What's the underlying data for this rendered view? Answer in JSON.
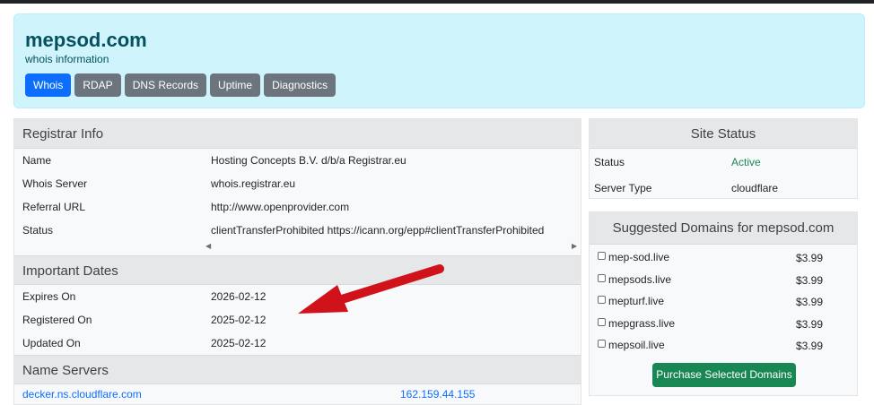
{
  "header": {
    "title": "mepsod.com",
    "subtitle": "whois information",
    "tabs": [
      {
        "label": "Whois"
      },
      {
        "label": "RDAP"
      },
      {
        "label": "DNS Records"
      },
      {
        "label": "Uptime"
      },
      {
        "label": "Diagnostics"
      }
    ]
  },
  "registrar": {
    "heading": "Registrar Info",
    "rows": [
      {
        "key": "Name",
        "value": "Hosting Concepts B.V. d/b/a Registrar.eu"
      },
      {
        "key": "Whois Server",
        "value": "whois.registrar.eu"
      },
      {
        "key": "Referral URL",
        "value": "http://www.openprovider.com"
      },
      {
        "key": "Status",
        "value": "clientTransferProhibited https://icann.org/epp#clientTransferProhibited"
      }
    ]
  },
  "dates": {
    "heading": "Important Dates",
    "rows": [
      {
        "key": "Expires On",
        "value": "2026-02-12"
      },
      {
        "key": "Registered On",
        "value": "2025-02-12"
      },
      {
        "key": "Updated On",
        "value": "2025-02-12"
      }
    ]
  },
  "nameservers": {
    "heading": "Name Servers",
    "rows": [
      {
        "host": "decker.ns.cloudflare.com",
        "ip": "162.159.44.155"
      }
    ]
  },
  "site_status": {
    "heading": "Site Status",
    "rows": [
      {
        "key": "Status",
        "value": "Active"
      },
      {
        "key": "Server Type",
        "value": "cloudflare"
      }
    ]
  },
  "suggested": {
    "heading": "Suggested Domains for mepsod.com",
    "items": [
      {
        "name": "mep-sod.live",
        "price": "$3.99"
      },
      {
        "name": "mepsods.live",
        "price": "$3.99"
      },
      {
        "name": "mepturf.live",
        "price": "$3.99"
      },
      {
        "name": "mepgrass.live",
        "price": "$3.99"
      },
      {
        "name": "mepsoil.live",
        "price": "$3.99"
      }
    ],
    "button_label": "Purchase Selected Domains"
  },
  "colors": {
    "hero_bg": "#cff4fc",
    "tab_active": "#0d6efd",
    "tab_inactive": "#6c757d",
    "status_active": "#198754",
    "purchase_button": "#198754",
    "annotation_arrow": "#d0121b"
  },
  "icons": {
    "scroll_left": "scroll-left-icon",
    "scroll_right": "scroll-right-icon",
    "annotation": "red-arrow-icon"
  }
}
